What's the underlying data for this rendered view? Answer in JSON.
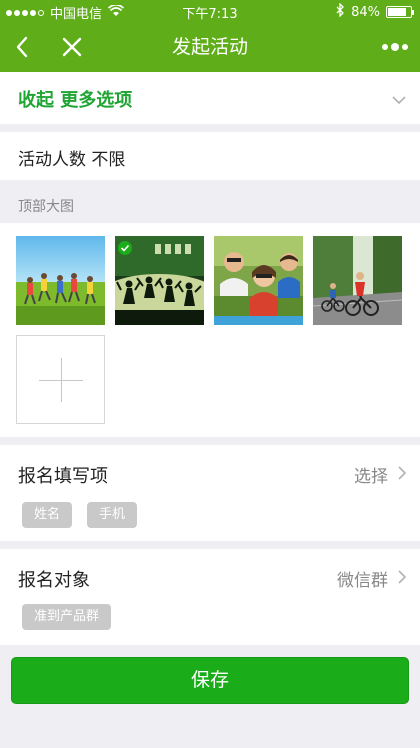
{
  "status_bar": {
    "carrier": "中国电信",
    "time": "下午7:13",
    "battery": "84%",
    "battery_level": 0.84,
    "icons": [
      "signal-dots",
      "wifi-icon",
      "bluetooth-icon",
      "battery-icon"
    ]
  },
  "nav": {
    "title": "发起活动",
    "icons": [
      "back-arrow-icon",
      "close-icon",
      "more-icon"
    ]
  },
  "more_options": {
    "label": "收起 更多选项"
  },
  "participants": {
    "label": "活动人数 不限"
  },
  "top_image": {
    "section_label": "顶部大图",
    "images": [
      {
        "name": "meadow-running-image",
        "selected": false
      },
      {
        "name": "silhouette-jump-image",
        "selected": true
      },
      {
        "name": "friends-selfie-image",
        "selected": false
      },
      {
        "name": "cycling-image",
        "selected": false
      }
    ]
  },
  "signup_fields": {
    "label": "报名填写项",
    "value": "选择",
    "tags": [
      "姓名",
      "手机"
    ]
  },
  "signup_target": {
    "label": "报名对象",
    "value": "微信群",
    "tags": [
      "准到产品群"
    ]
  },
  "save_label": "保存",
  "colors": {
    "nav_green": "#5fae19",
    "accent_green": "#20a534",
    "button_green": "#1aad19",
    "tag_grey": "#c9c9c9"
  }
}
